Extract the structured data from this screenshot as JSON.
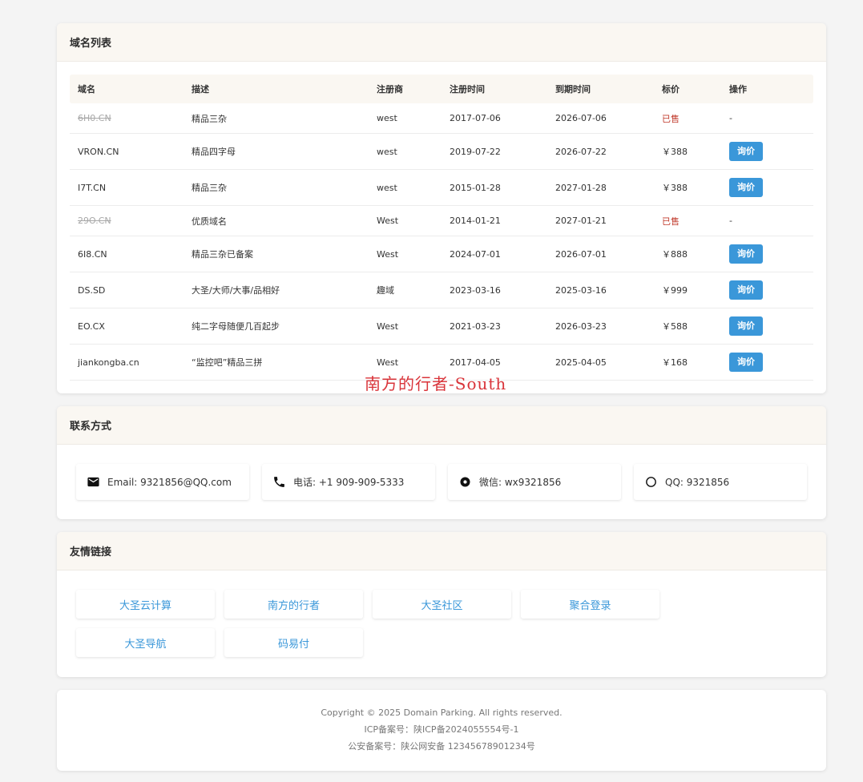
{
  "domain_section": {
    "title": "域名列表",
    "columns": [
      "域名",
      "描述",
      "注册商",
      "注册时间",
      "到期时间",
      "标价",
      "操作"
    ],
    "rows": [
      {
        "domain": "6H0.CN",
        "desc": "精品三杂",
        "registrar": "west",
        "reg_date": "2017-07-06",
        "exp_date": "2026-07-06",
        "price": "已售",
        "action": "-",
        "sold": true
      },
      {
        "domain": "VRON.CN",
        "desc": "精品四字母",
        "registrar": "west",
        "reg_date": "2019-07-22",
        "exp_date": "2026-07-22",
        "price": "￥388",
        "action": "询价",
        "sold": false
      },
      {
        "domain": "I7T.CN",
        "desc": "精品三杂",
        "registrar": "west",
        "reg_date": "2015-01-28",
        "exp_date": "2027-01-28",
        "price": "￥388",
        "action": "询价",
        "sold": false
      },
      {
        "domain": "29O.CN",
        "desc": "优质域名",
        "registrar": "West",
        "reg_date": "2014-01-21",
        "exp_date": "2027-01-21",
        "price": "已售",
        "action": "-",
        "sold": true
      },
      {
        "domain": "6I8.CN",
        "desc": "精品三杂已备案",
        "registrar": "West",
        "reg_date": "2024-07-01",
        "exp_date": "2026-07-01",
        "price": "￥888",
        "action": "询价",
        "sold": false
      },
      {
        "domain": "DS.SD",
        "desc": "大圣/大师/大事/品相好",
        "registrar": "趣域",
        "reg_date": "2023-03-16",
        "exp_date": "2025-03-16",
        "price": "￥999",
        "action": "询价",
        "sold": false
      },
      {
        "domain": "EO.CX",
        "desc": "纯二字母随便几百起步",
        "registrar": "West",
        "reg_date": "2021-03-23",
        "exp_date": "2026-03-23",
        "price": "￥588",
        "action": "询价",
        "sold": false
      },
      {
        "domain": "jiankongba.cn",
        "desc": "“监控吧”精品三拼",
        "registrar": "West",
        "reg_date": "2017-04-05",
        "exp_date": "2025-04-05",
        "price": "￥168",
        "action": "询价",
        "sold": false
      }
    ]
  },
  "watermark": "南方的行者-South",
  "contact_section": {
    "title": "联系方式",
    "items": [
      {
        "icon": "email-icon",
        "text": "Email: 9321856@QQ.com"
      },
      {
        "icon": "phone-icon",
        "text": "电话: +1 909-909-5333"
      },
      {
        "icon": "wechat-icon",
        "text": "微信: wx9321856"
      },
      {
        "icon": "qq-icon",
        "text": "QQ: 9321856"
      }
    ]
  },
  "links_section": {
    "title": "友情链接",
    "items": [
      "大圣云计算",
      "南方的行者",
      "大圣社区",
      "聚合登录",
      "大圣导航",
      "码易付"
    ]
  },
  "footer": {
    "copyright": "Copyright © 2025 Domain Parking. All rights reserved.",
    "icp": "ICP备案号：陕ICP备2024055554号-1",
    "police": "公安备案号：陕公网安备 12345678901234号"
  },
  "colors": {
    "accent": "#3a97d9",
    "sold": "#c0392b",
    "watermark": "#d9343a",
    "header_bg": "#faf7f2"
  }
}
